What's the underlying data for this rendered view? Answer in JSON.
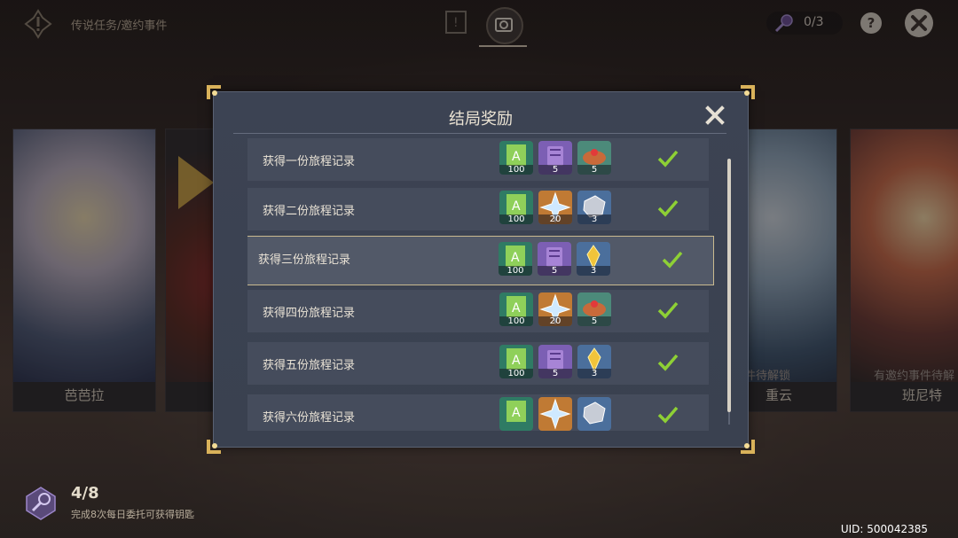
{
  "header": {
    "breadcrumb": "传说任务/邀约事件",
    "key_count": "0/3"
  },
  "help_label": "?",
  "characters": [
    {
      "name": "芭芭拉",
      "lock_text": ""
    },
    {
      "name": "重云",
      "lock_text": "约事件待解锁"
    },
    {
      "name": "班尼特",
      "lock_text": "有邀约事件待解"
    }
  ],
  "dialog": {
    "title": "结局奖励",
    "rows": [
      {
        "label": "获得一份旅程记录",
        "items": [
          {
            "icon": "hero-wit-icon",
            "count": "100"
          },
          {
            "icon": "purple-book-icon",
            "count": "5"
          },
          {
            "icon": "food-dish-icon",
            "count": "5"
          }
        ]
      },
      {
        "label": "获得二份旅程记录",
        "items": [
          {
            "icon": "hero-wit-icon",
            "count": "100"
          },
          {
            "icon": "primogem-icon",
            "count": "20"
          },
          {
            "icon": "ore-icon",
            "count": "3"
          }
        ]
      },
      {
        "label": "获得三份旅程记录",
        "items": [
          {
            "icon": "hero-wit-icon",
            "count": "100"
          },
          {
            "icon": "purple-book-icon",
            "count": "5"
          },
          {
            "icon": "gold-crystal-icon",
            "count": "3"
          }
        ]
      },
      {
        "label": "获得四份旅程记录",
        "items": [
          {
            "icon": "hero-wit-icon",
            "count": "100"
          },
          {
            "icon": "primogem-icon",
            "count": "20"
          },
          {
            "icon": "food-dish-icon",
            "count": "5"
          }
        ]
      },
      {
        "label": "获得五份旅程记录",
        "items": [
          {
            "icon": "hero-wit-icon",
            "count": "100"
          },
          {
            "icon": "purple-book-icon",
            "count": "5"
          },
          {
            "icon": "gold-crystal-icon",
            "count": "3"
          }
        ]
      },
      {
        "label": "获得六份旅程记录",
        "items": [
          {
            "icon": "hero-wit-icon",
            "count": ""
          },
          {
            "icon": "primogem-icon",
            "count": ""
          },
          {
            "icon": "ore-icon",
            "count": ""
          }
        ]
      }
    ]
  },
  "progress": {
    "count": "4/8",
    "hint": "完成8次每日委托可获得钥匙"
  },
  "uid": "UID: 500042385",
  "colors": {
    "accent_gold": "#d9b25a",
    "check_green": "#8ed035",
    "dialog_bg": "#3c4353"
  }
}
